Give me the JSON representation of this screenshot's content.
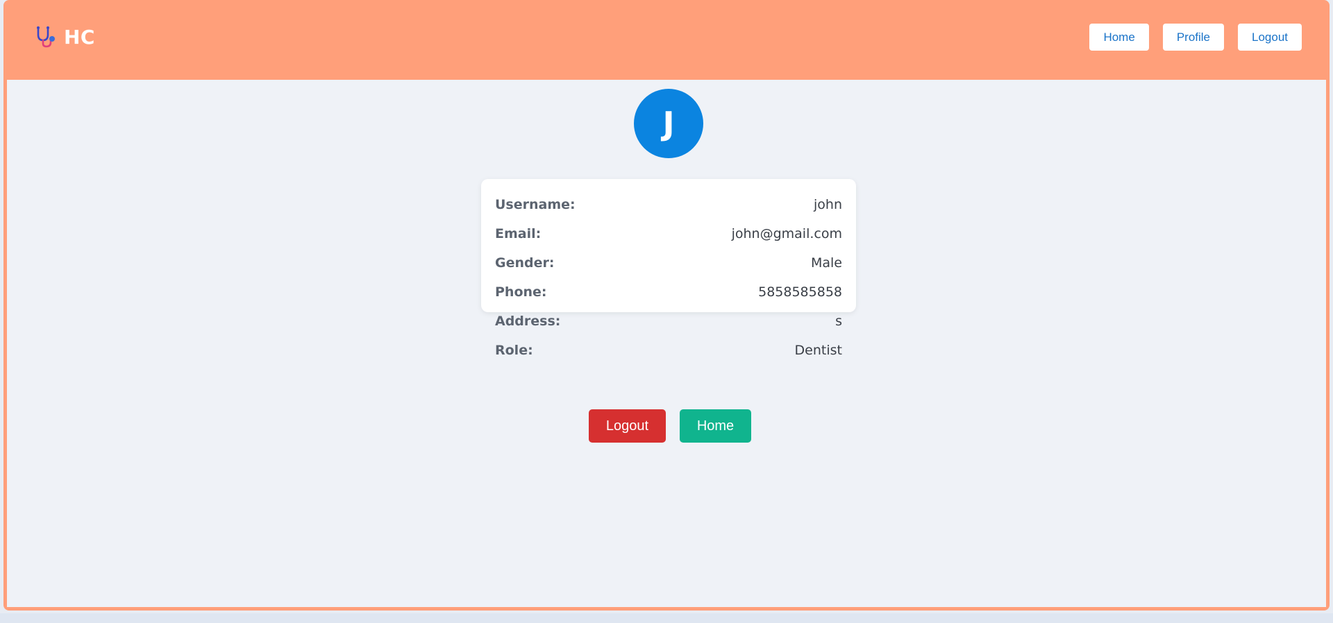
{
  "navbar": {
    "brand": "HC",
    "brand_icon": "stethoscope-icon",
    "links": {
      "home": "Home",
      "profile": "Profile",
      "logout": "Logout"
    }
  },
  "avatar": {
    "initial": "J"
  },
  "profile": {
    "rows": [
      {
        "label": "Username:",
        "value": "john"
      },
      {
        "label": "Email:",
        "value": "john@gmail.com"
      },
      {
        "label": "Gender:",
        "value": "Male"
      },
      {
        "label": "Phone:",
        "value": "5858585858"
      },
      {
        "label": "Address:",
        "value": "s"
      },
      {
        "label": "Role:",
        "value": "Dentist"
      }
    ]
  },
  "actions": {
    "logout": "Logout",
    "home": "Home"
  },
  "colors": {
    "header": "#ff9f7a",
    "avatar": "#0b84e0",
    "logout_button": "#d63030",
    "home_button": "#10b48e"
  }
}
